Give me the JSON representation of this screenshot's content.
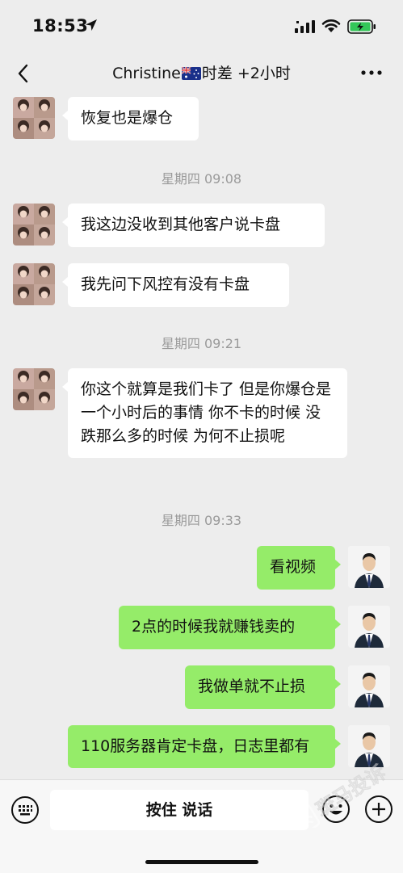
{
  "status_bar": {
    "time": "18:53"
  },
  "header": {
    "title_prefix": "Christine",
    "title_suffix": "时差 +2小时"
  },
  "messages": [
    {
      "text": "恢复也是爆仓"
    },
    {
      "time": "星期四 09:08"
    },
    {
      "text": "我这边没收到其他客户说卡盘"
    },
    {
      "text": "我先问下风控有没有卡盘"
    },
    {
      "time": "星期四 09:21"
    },
    {
      "text": "你这个就算是我们卡了 但是你爆仓是一个小时后的事情 你不卡的时候 没跌那么多的时候 为何不止损呢"
    },
    {
      "time": "星期四 09:33"
    },
    {
      "text": "看视频"
    },
    {
      "text": "2点的时候我就赚钱卖的"
    },
    {
      "text": "我做单就不止损"
    },
    {
      "text": "110服务器肯定卡盘，日志里都有"
    }
  ],
  "input_bar": {
    "hold_to_talk": "按住 说话"
  },
  "watermark": {
    "text": "斑马投诉"
  }
}
